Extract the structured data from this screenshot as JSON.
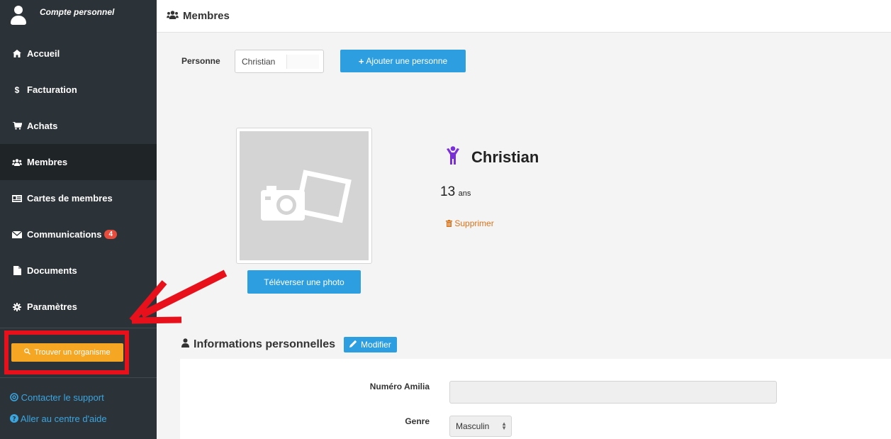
{
  "sidebar": {
    "title": "Compte personnel",
    "items": [
      {
        "label": "Accueil",
        "icon": "home-icon"
      },
      {
        "label": "Facturation",
        "icon": "dollar-icon"
      },
      {
        "label": "Achats",
        "icon": "cart-icon"
      },
      {
        "label": "Membres",
        "icon": "users-icon",
        "active": true
      },
      {
        "label": "Cartes de membres",
        "icon": "id-card-icon"
      },
      {
        "label": "Communications",
        "icon": "envelope-icon",
        "badge": "4"
      },
      {
        "label": "Documents",
        "icon": "file-icon"
      },
      {
        "label": "Paramètres",
        "icon": "gear-icon"
      }
    ],
    "find_button": "Trouver un organisme",
    "support_link": "Contacter le support",
    "help_link": "Aller au centre d'aide"
  },
  "header": {
    "title": "Membres"
  },
  "main": {
    "person_label": "Personne",
    "person_value": "Christian",
    "add_button": "Ajouter une personne",
    "upload_button": "Téléverser une photo",
    "name": "Christian",
    "age_value": "13",
    "age_unit": "ans",
    "delete_link": "Supprimer",
    "info_title": "Informations personnelles",
    "edit_button": "Modifier",
    "fields": {
      "amilia_label": "Numéro Amilia",
      "amilia_value": "",
      "genre_label": "Genre",
      "genre_value": "Masculin"
    }
  },
  "colors": {
    "sidebar_bg": "#2c3338",
    "accent_blue": "#2d9ee0",
    "find_orange": "#f5a623",
    "highlight_red": "#e8111b",
    "child_icon_purple": "#7b2fd9",
    "delete_orange": "#d9731a"
  }
}
